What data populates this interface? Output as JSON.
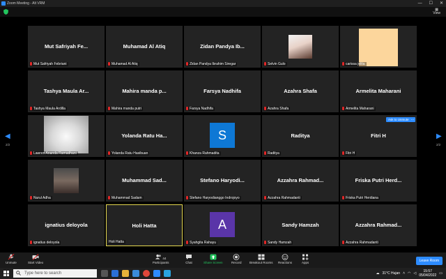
{
  "window": {
    "title": "Zoom Meeting - Alt VRM"
  },
  "top": {
    "view_label": "View"
  },
  "pages": {
    "left": "2/2",
    "right": "2/2"
  },
  "tiles": [
    {
      "big": "Mut Safriyah Fe...",
      "label": "Mut Safriyah Febriani"
    },
    {
      "big": "Muhamad Al Atiq",
      "label": "Muhamad Al Atiq"
    },
    {
      "big": "Zidan Pandya Ib...",
      "label": "Zidan Pandya Ibrahim Siregar"
    },
    {
      "big": "",
      "label": "Selvin Gulo"
    },
    {
      "big": "",
      "label": "carissa jelita"
    },
    {
      "big": "Tashya Maula Ar...",
      "label": "Tashya Maula Ardilla"
    },
    {
      "big": "Mahira manda p...",
      "label": "Mahira manda putri"
    },
    {
      "big": "Farsya Nadhifa",
      "label": "Farsya Nadhifa"
    },
    {
      "big": "Azahra Shafa",
      "label": "Azahra Shafa"
    },
    {
      "big": "Armelita Maharani",
      "label": "Armelita Maharani"
    },
    {
      "big": "",
      "label": "Lawren Ananda Ramadhani"
    },
    {
      "big": "Yolanda Ratu Ha...",
      "label": "Yolanda Ratu Hasibuan"
    },
    {
      "big": "",
      "label": "Khanza Rahmadita",
      "avatar": "S"
    },
    {
      "big": "Raditya",
      "label": "Raditya"
    },
    {
      "big": "Fitri H",
      "label": "Fitri H"
    },
    {
      "big": "",
      "label": "Nurul Adha"
    },
    {
      "big": "Muhammad Sad...",
      "label": "Muhammad Sadam"
    },
    {
      "big": "Stefano Haryodi...",
      "label": "Stefano Haryodianggo Indrojoyo"
    },
    {
      "big": "Azzahra Rahmad...",
      "label": "Azzahra Rahmadanti"
    },
    {
      "big": "Friska Putri Herd...",
      "label": "Friska Putri Herdiana"
    },
    {
      "big": "ignatius deloyola",
      "label": "ignatius deloyola"
    },
    {
      "big": "Holi Hatta",
      "label": "Holi Hatta"
    },
    {
      "big": "",
      "label": "Syahgita Rahayu",
      "avatar": "A"
    },
    {
      "big": "Sandy Hamzah",
      "label": "Sandy Hamzah"
    },
    {
      "big": "Azzahra Rahmad...",
      "label": "Azzahra Rahmadanti"
    }
  ],
  "add_button": "Ask to Unmute",
  "more_button": "...",
  "toolbar": {
    "unmute": "Unmute",
    "start_video": "Start Video",
    "participants": "Participants",
    "participants_count": "44",
    "chat": "Chat",
    "share_screen": "Share Screen",
    "record": "Record",
    "breakout": "Breakout Rooms",
    "reactions": "Reactions",
    "apps": "Apps",
    "leave": "Leave Room"
  },
  "taskbar": {
    "search_placeholder": "Type here to search",
    "weather": "31°C  Hujan",
    "time": "15:57",
    "date": "05/04/2022"
  },
  "colors": {
    "accent": "#2d8cff",
    "active_border": "#e6d950",
    "tile_bg": "#232323",
    "mic_muted": "#e02828"
  }
}
